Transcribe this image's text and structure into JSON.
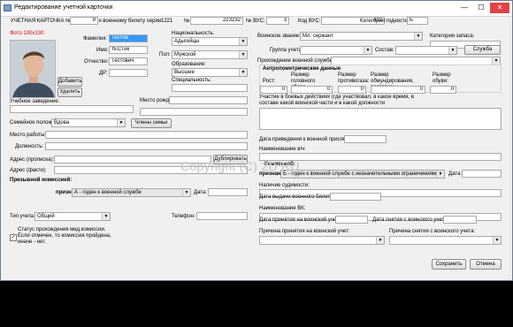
{
  "window": {
    "title": "Редактирование учетной карточки",
    "minimize": "—",
    "maximize": "☐",
    "close": "✕"
  },
  "header": {
    "card_label": "УЧЕТНАЯ КАРТОЧКА №",
    "card_no": "9",
    "ticket_label": "к военному билету серии",
    "ticket_series": "1221",
    "no_label": "№",
    "ticket_no": "223232",
    "vus_label": "№ ВУС:",
    "vus_no": "3",
    "vus_code_label": "Код ВУС:",
    "vus_code": "432",
    "fitness_label": "Категория годности:",
    "fitness": "Б"
  },
  "photo": {
    "label": "Фото 100х130",
    "add": "Добавить",
    "remove": "Удалить"
  },
  "person": {
    "surname_label": "Фамилия:",
    "surname": "Тестов",
    "name_label": "Имя:",
    "name": "тЕСТик",
    "patronymic_label": "Отчество:",
    "patronymic": "Тестович",
    "dob_label": "ДР:",
    "dob": "",
    "nationality_label": "Национальность:",
    "nationality": "Адыгейцы",
    "sex_label": "Пол:",
    "sex": "Мужской",
    "education_label": "Образование:",
    "education": "Высшее",
    "specialty_label": "Специальность:",
    "specialty": "",
    "school_label": "Учебное заведение:",
    "school": "",
    "birthplace_label": "Место рожд.:",
    "birthplace": "",
    "family_label": "Семейное положение:",
    "family": "Вдова",
    "family_btn": "Члены семьи",
    "work_label": "Место работы:",
    "work": "",
    "position_label": "Должность:",
    "position": "",
    "addr_reg_label": "Адрес (прописка):",
    "addr_reg": "",
    "dup_btn": "Дублировать",
    "addr_fact_label": "Адрес (факти):",
    "addr_fact": ""
  },
  "draft": {
    "title": "Призывной комиссией:",
    "recognized_label": "признан:",
    "recognized": "А - годен к военной службе",
    "date_label": "Дата:",
    "date": ""
  },
  "account": {
    "type_label": "Тип учета:",
    "type": "Общий",
    "phone_label": "Телефон:",
    "phone": "",
    "status_text": "Статус прохождения мед.комиссии. Если отмечен, то комиссия пройдена, иначе - нет.",
    "status_checked": "✓"
  },
  "military": {
    "rank_label": "Воинское звание:",
    "rank": "Мл. сержант",
    "reserve_cat_label": "Категория запаса:",
    "reserve_cat": "",
    "group_label": "Группа учета:",
    "group": "",
    "composition_label": "Состав:",
    "composition": "",
    "service_btn": "Служба",
    "service_label": "Прохождение военной службы:",
    "service": ""
  },
  "anthro": {
    "title": "Антропометрические данные",
    "height_label": "Рост:",
    "height": "0",
    "head_label": "Размер головного убора",
    "head": "0",
    "gas_label": "Размер противогаза:",
    "gas": "0",
    "shoe_label": "Размер обмундирования, ростовка:",
    "shoe": "0",
    "boots_label": "Размер обуви:",
    "boots": "0"
  },
  "combat": {
    "label": "Участие в боевых действиях (где участвовал, в какое время, в составе какой воинской части и в какой должности",
    "value": ""
  },
  "oath": {
    "date_label": "Дата приведения к военной присяге:",
    "date": "",
    "vch_label": "Наименование в/ч:",
    "vch": ""
  },
  "commission": {
    "title": "Комиссией:",
    "recognized_label": "признан:",
    "recognized": "Б - годен к военной службе с незначительными ограничениями",
    "date_label": "Дата:",
    "date": "",
    "criminal_label": "Наличие судимости:",
    "criminal": "",
    "ticket_date_label": "Дата выдачи военного билета:",
    "ticket_date": "",
    "vk_label": "Наименование ВК:",
    "vk": "",
    "accept_date_label": "Дата принятия на воинский учет:",
    "accept_date": "",
    "remove_date_label": "Дата снятия с воинского учета:",
    "remove_date": "",
    "accept_reason_label": "Причина принятия на воинский учет:",
    "accept_reason": "",
    "remove_reason_label": "Причина снятия с воинского учета:",
    "remove_reason": ""
  },
  "footer": {
    "save": "Сохранить",
    "cancel": "Отмена"
  },
  "watermark": "Copyright (C) 2D RU"
}
